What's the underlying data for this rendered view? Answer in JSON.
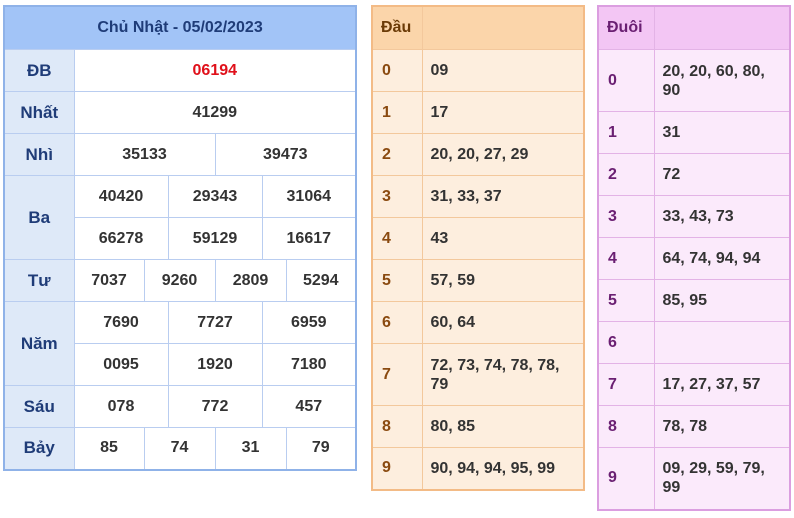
{
  "results": {
    "title": "Chủ Nhật - 05/02/2023",
    "db": {
      "label": "ĐB",
      "values": [
        "06194"
      ]
    },
    "nhat": {
      "label": "Nhất",
      "values": [
        "41299"
      ]
    },
    "nhi": {
      "label": "Nhì",
      "values": [
        "35133",
        "39473"
      ]
    },
    "ba": {
      "label": "Ba",
      "values": [
        "40420",
        "29343",
        "31064",
        "66278",
        "59129",
        "16617"
      ]
    },
    "tu": {
      "label": "Tư",
      "values": [
        "7037",
        "9260",
        "2809",
        "5294"
      ]
    },
    "nam": {
      "label": "Năm",
      "values": [
        "7690",
        "7727",
        "6959",
        "0095",
        "1920",
        "7180"
      ]
    },
    "sau": {
      "label": "Sáu",
      "values": [
        "078",
        "772",
        "457"
      ]
    },
    "bay": {
      "label": "Bảy",
      "values": [
        "85",
        "74",
        "31",
        "79"
      ]
    }
  },
  "dau": {
    "header": "Đầu",
    "rows": [
      {
        "key": "0",
        "value": "09"
      },
      {
        "key": "1",
        "value": "17"
      },
      {
        "key": "2",
        "value": "20, 20, 27, 29"
      },
      {
        "key": "3",
        "value": "31, 33, 37"
      },
      {
        "key": "4",
        "value": "43"
      },
      {
        "key": "5",
        "value": "57, 59"
      },
      {
        "key": "6",
        "value": "60, 64"
      },
      {
        "key": "7",
        "value": "72, 73, 74, 78, 78, 79"
      },
      {
        "key": "8",
        "value": "80, 85"
      },
      {
        "key": "9",
        "value": "90, 94, 94, 95, 99"
      }
    ]
  },
  "duoi": {
    "header": "Đuôi",
    "rows": [
      {
        "key": "0",
        "value": "20, 20, 60, 80, 90"
      },
      {
        "key": "1",
        "value": "31"
      },
      {
        "key": "2",
        "value": "72"
      },
      {
        "key": "3",
        "value": "33, 43, 73"
      },
      {
        "key": "4",
        "value": "64, 74, 94, 94"
      },
      {
        "key": "5",
        "value": "85, 95"
      },
      {
        "key": "6",
        "value": ""
      },
      {
        "key": "7",
        "value": "17, 27, 37, 57"
      },
      {
        "key": "8",
        "value": "78, 78"
      },
      {
        "key": "9",
        "value": "09, 29, 59, 79, 99"
      }
    ]
  },
  "colors": {
    "results_header": "#a2c4f7",
    "results_label_bg": "#dee9f8",
    "special_prize": "#e0101a",
    "dau_header": "#fbd5aa",
    "dau_body": "#fdeede",
    "duoi_header": "#f3c6f4",
    "duoi_body": "#fbeafb"
  }
}
